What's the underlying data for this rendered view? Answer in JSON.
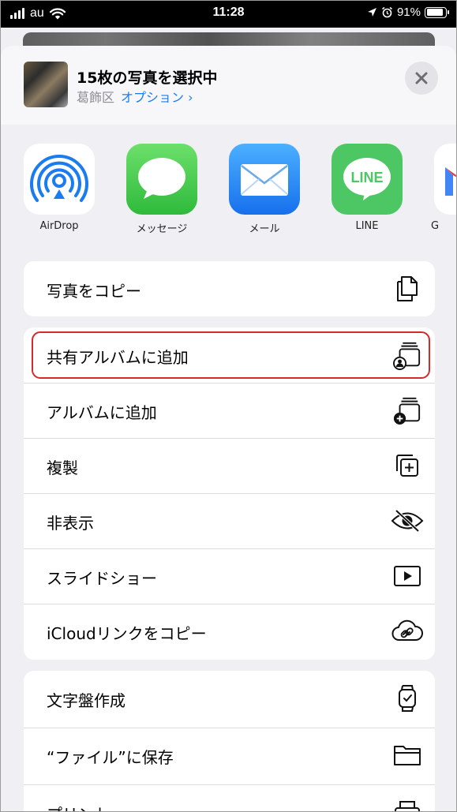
{
  "status_bar": {
    "carrier": "au",
    "time": "11:28",
    "battery": "91%",
    "battery_level": 0.91
  },
  "header": {
    "title": "15枚の写真を選択中",
    "location": "葛飾区",
    "options_label": "オプション",
    "options_chevron": "›"
  },
  "apps": [
    {
      "label": "AirDrop",
      "icon": "airdrop-icon"
    },
    {
      "label": "メッセージ",
      "icon": "messages-icon"
    },
    {
      "label": "メール",
      "icon": "mail-icon"
    },
    {
      "label": "LINE",
      "icon": "line-icon",
      "icon_text": "LINE"
    },
    {
      "label": "G",
      "icon": "gmail-icon"
    }
  ],
  "group1": [
    {
      "label": "写真をコピー",
      "icon": "copy-icon"
    }
  ],
  "group2": [
    {
      "label": "共有アルバムに追加",
      "icon": "shared-album-icon"
    },
    {
      "label": "アルバムに追加",
      "icon": "add-album-icon"
    },
    {
      "label": "複製",
      "icon": "duplicate-icon"
    },
    {
      "label": "非表示",
      "icon": "hide-icon"
    },
    {
      "label": "スライドショー",
      "icon": "slideshow-icon"
    },
    {
      "label": "iCloudリンクをコピー",
      "icon": "icloud-link-icon"
    }
  ],
  "group3": [
    {
      "label": "文字盤作成",
      "icon": "watch-face-icon"
    },
    {
      "label": "“ファイル”に保存",
      "icon": "folder-icon"
    },
    {
      "label": "プリント",
      "icon": "print-icon"
    }
  ],
  "colors": {
    "accent": "#1a7cf0",
    "highlight": "#d42a2a",
    "line_green": "#4cc764",
    "messages_green": "#3fc34d",
    "mail_blue": "#1f8ff7"
  }
}
